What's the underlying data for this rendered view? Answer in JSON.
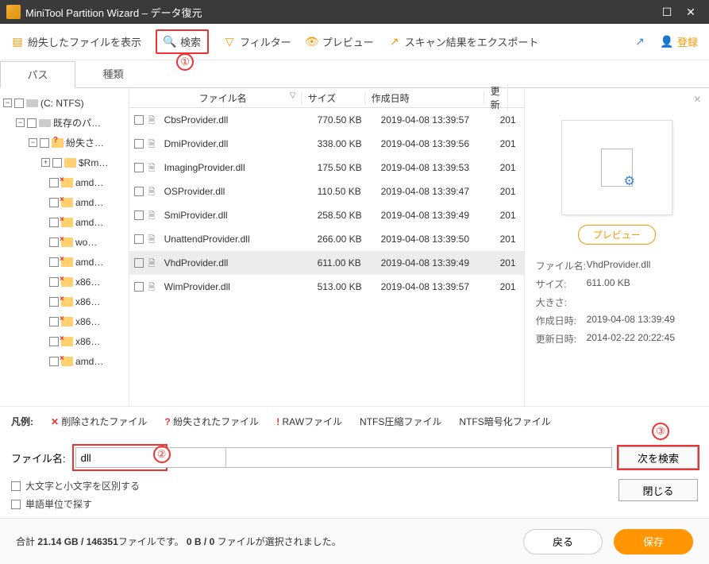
{
  "titlebar": {
    "app": "MiniTool Partition Wizard",
    "sub": "データ復元"
  },
  "toolbar": {
    "show_lost": "紛失したファイルを表示",
    "search": "検索",
    "filter": "フィルター",
    "preview": "プレビュー",
    "export": "スキャン結果をエクスポート",
    "register": "登録"
  },
  "tabs": {
    "path": "パス",
    "type": "種類"
  },
  "tree": {
    "drive": "(C: NTFS)",
    "existing": "既存のパ…",
    "lost": "紛失さ…",
    "rm": "$Rm…",
    "items": [
      "amd…",
      "amd…",
      "amd…",
      "wo…",
      "amd…",
      "x86…",
      "x86…",
      "x86…",
      "x86…",
      "amd…"
    ]
  },
  "columns": {
    "name": "ファイル名",
    "size": "サイズ",
    "created": "作成日時",
    "updated": "更新"
  },
  "files": [
    {
      "name": "CbsProvider.dll",
      "size": "770.50 KB",
      "created": "2019-04-08 13:39:57",
      "upd": "201"
    },
    {
      "name": "DmiProvider.dll",
      "size": "338.00 KB",
      "created": "2019-04-08 13:39:56",
      "upd": "201"
    },
    {
      "name": "ImagingProvider.dll",
      "size": "175.50 KB",
      "created": "2019-04-08 13:39:53",
      "upd": "201"
    },
    {
      "name": "OSProvider.dll",
      "size": "110.50 KB",
      "created": "2019-04-08 13:39:47",
      "upd": "201"
    },
    {
      "name": "SmiProvider.dll",
      "size": "258.50 KB",
      "created": "2019-04-08 13:39:49",
      "upd": "201"
    },
    {
      "name": "UnattendProvider.dll",
      "size": "266.00 KB",
      "created": "2019-04-08 13:39:50",
      "upd": "201"
    },
    {
      "name": "VhdProvider.dll",
      "size": "611.00 KB",
      "created": "2019-04-08 13:39:49",
      "upd": "201",
      "selected": true
    },
    {
      "name": "WimProvider.dll",
      "size": "513.00 KB",
      "created": "2019-04-08 13:39:57",
      "upd": "201"
    }
  ],
  "preview": {
    "btn": "プレビュー",
    "labels": {
      "name": "ファイル名:",
      "size": "サイズ:",
      "dim": "大きさ:",
      "created": "作成日時:",
      "updated": "更新日時:"
    },
    "name": "VhdProvider.dll",
    "size": "611.00 KB",
    "dim": "",
    "created": "2019-04-08 13:39:49",
    "updated": "2014-02-22 20:22:45"
  },
  "legend": {
    "title": "凡例:",
    "deleted": "削除されたファイル",
    "lost": "紛失されたファイル",
    "raw": "RAWファイル",
    "ntfs_comp": "NTFS圧縮ファイル",
    "ntfs_enc": "NTFS暗号化ファイル"
  },
  "search": {
    "label": "ファイル名:",
    "value": "dll",
    "case": "大文字と小文字を区別する",
    "word": "単語単位で探す",
    "next": "次を検索",
    "close": "閉じる"
  },
  "footer": {
    "text_a": "合計 ",
    "bold1": "21.14 GB / 146351",
    "text_b": "ファイルです。",
    "bold2": "0 B / 0",
    "text_c": " ファイルが選択されました。",
    "back": "戻る",
    "save": "保存"
  },
  "annot": {
    "n1": "①",
    "n2": "②",
    "n3": "③"
  }
}
